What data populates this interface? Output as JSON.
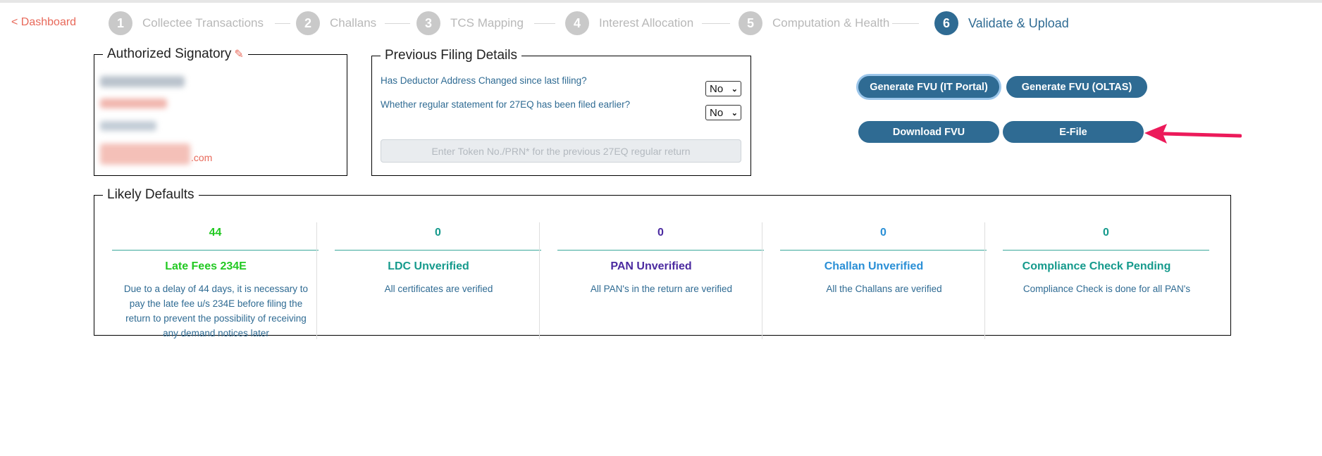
{
  "nav": {
    "back_label": "< Dashboard"
  },
  "steps": [
    {
      "num": "1",
      "label": "Collectee Transactions"
    },
    {
      "num": "2",
      "label": "Challans"
    },
    {
      "num": "3",
      "label": "TCS Mapping"
    },
    {
      "num": "4",
      "label": "Interest Allocation"
    },
    {
      "num": "5",
      "label": "Computation & Health"
    },
    {
      "num": "6",
      "label": "Validate & Upload"
    }
  ],
  "active_step": 6,
  "signatory": {
    "title": "Authorized Signatory",
    "edit_icon": "pencil-icon",
    "email_suffix": ".com"
  },
  "previous_filing": {
    "title": "Previous Filing Details",
    "q1": "Has Deductor Address Changed since last filing?",
    "q1_value": "No",
    "q2": "Whether regular statement for 27EQ has been filed earlier?",
    "q2_value": "No",
    "token_placeholder": "Enter Token No./PRN* for the previous 27EQ regular return"
  },
  "actions": {
    "generate_it": "Generate FVU (IT Portal)",
    "generate_oltas": "Generate FVU (OLTAS)",
    "download": "Download FVU",
    "efile": "E-File"
  },
  "defaults": {
    "title": "Likely Defaults",
    "items": [
      {
        "value": "44",
        "title": "Late Fees 234E",
        "desc": "Due to a delay of 44 days, it is necessary to pay the late fee u/s 234E before filing the return to prevent the possibility of receiving any demand notices later",
        "color": "#22c922"
      },
      {
        "value": "0",
        "title": "LDC Unverified",
        "desc": "All certificates are verified",
        "color": "#159a8c"
      },
      {
        "value": "0",
        "title": "PAN Unverified",
        "desc": "All PAN's in the return are verified",
        "color": "#4b2aa0"
      },
      {
        "value": "0",
        "title": "Challan Unverified",
        "desc": "All the Challans are verified",
        "color": "#2a8fd6"
      },
      {
        "value": "0",
        "title": "Compliance Check Pending",
        "desc": "Compliance Check is done for all PAN's",
        "color": "#159a8c"
      }
    ]
  },
  "colors": {
    "accent": "#2f6b93",
    "alert": "#e8695a",
    "arrow": "#ec1a5a"
  }
}
